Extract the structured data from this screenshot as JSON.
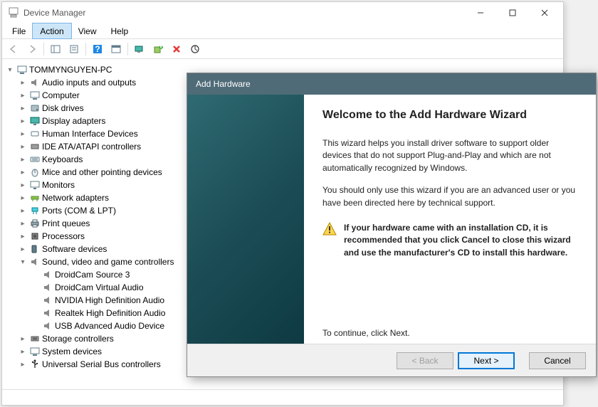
{
  "window": {
    "title": "Device Manager"
  },
  "menubar": {
    "file": "File",
    "action": "Action",
    "view": "View",
    "help": "Help"
  },
  "tree": {
    "root": "TOMMYNGUYEN-PC",
    "cat": {
      "audio": "Audio inputs and outputs",
      "computer": "Computer",
      "disks": "Disk drives",
      "display": "Display adapters",
      "hid": "Human Interface Devices",
      "ide": "IDE ATA/ATAPI controllers",
      "keyboards": "Keyboards",
      "mice": "Mice and other pointing devices",
      "monitors": "Monitors",
      "network": "Network adapters",
      "ports": "Ports (COM & LPT)",
      "printq": "Print queues",
      "processors": "Processors",
      "software": "Software devices",
      "sound": "Sound, video and game controllers",
      "storage": "Storage controllers",
      "system": "System devices",
      "usb": "Universal Serial Bus controllers"
    },
    "sound_children": {
      "d0": "DroidCam Source 3",
      "d1": "DroidCam Virtual Audio",
      "d2": "NVIDIA High Definition Audio",
      "d3": "Realtek High Definition Audio",
      "d4": "USB Advanced Audio Device"
    }
  },
  "wizard": {
    "title": "Add Hardware",
    "heading": "Welcome to the Add Hardware Wizard",
    "p1": "This wizard helps you install driver software to support older devices that do not support Plug-and-Play and which are not automatically recognized by Windows.",
    "p2": "You should only use this wizard if you are an advanced user or you have been directed here by technical support.",
    "warn": "If your hardware came with an installation CD, it is recommended that you click Cancel to close this wizard and use the manufacturer's CD to install this hardware.",
    "continue": "To continue, click Next.",
    "back": "< Back",
    "next": "Next >",
    "cancel": "Cancel"
  }
}
